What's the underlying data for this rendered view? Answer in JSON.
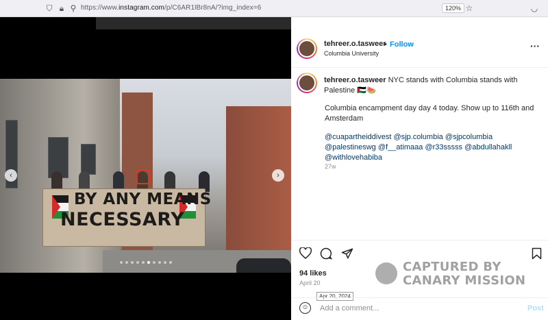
{
  "browser": {
    "url_prefix": "https://www.",
    "url_host": "instagram.com",
    "url_path": "/p/C6AR1lBr8nA/?img_index=6",
    "zoom": "120%"
  },
  "post": {
    "author": "tehreer.o.tasweer",
    "follow_label": "Follow",
    "location": "Columbia University",
    "caption_line1": "NYC stands with Columbia stands with",
    "caption_line2": "Palestine 🇵🇸🍉",
    "body_line1": "Columbia encampment day day 4 today. Show up to 116th and",
    "body_line2": "Amsterdam",
    "tags_line1": "@cuapartheiddivest @sjp.columbia @sjpcolumbia",
    "tags_line2": "@palestineswg @f__atimaaa @r33sssss @abdullahakll",
    "tags_line3": "@withlovehabiba",
    "age": "27w",
    "likes": "94 likes",
    "date": "April 20",
    "tooltip": "Apr 20, 2024",
    "comment_placeholder": "Add a comment...",
    "post_label": "Post",
    "more_icon": "more-dots-icon"
  },
  "photo": {
    "banner_line1": "BY ANY MEANS",
    "banner_line2": "NECESSARY",
    "carousel_dots": 10,
    "active_dot": 6
  },
  "watermark": {
    "line1": "CAPTURED BY",
    "line2": "CANARY MISSION"
  },
  "colors": {
    "link": "#00376b",
    "follow": "#0095f6",
    "muted": "#8e8e8e"
  }
}
